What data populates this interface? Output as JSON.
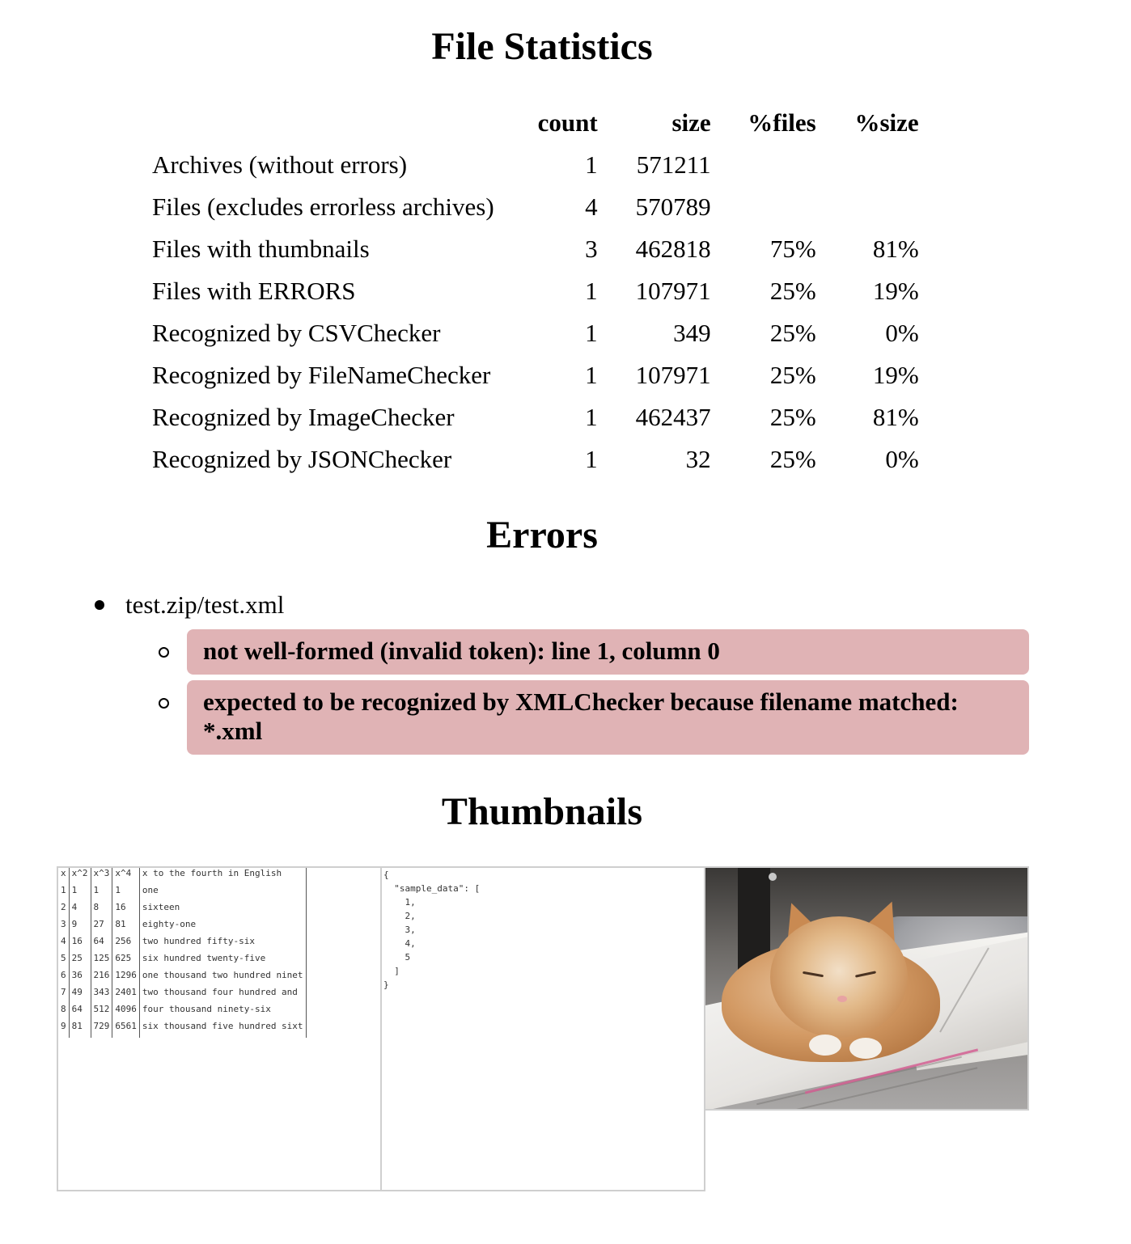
{
  "stats": {
    "title": "File Statistics",
    "headers": {
      "label": "",
      "count": "count",
      "size": "size",
      "pct_files": "%files",
      "pct_size": "%size"
    },
    "rows": [
      {
        "label": "Archives (without errors)",
        "count": "1",
        "size": "571211",
        "pct_files": "",
        "pct_size": ""
      },
      {
        "label": "Files (excludes errorless archives)",
        "count": "4",
        "size": "570789",
        "pct_files": "",
        "pct_size": ""
      },
      {
        "label": "Files with thumbnails",
        "count": "3",
        "size": "462818",
        "pct_files": "75%",
        "pct_size": "81%"
      },
      {
        "label": "Files with ERRORS",
        "count": "1",
        "size": "107971",
        "pct_files": "25%",
        "pct_size": "19%"
      },
      {
        "label": "Recognized by CSVChecker",
        "count": "1",
        "size": "349",
        "pct_files": "25%",
        "pct_size": "0%"
      },
      {
        "label": "Recognized by FileNameChecker",
        "count": "1",
        "size": "107971",
        "pct_files": "25%",
        "pct_size": "19%"
      },
      {
        "label": "Recognized by ImageChecker",
        "count": "1",
        "size": "462437",
        "pct_files": "25%",
        "pct_size": "81%"
      },
      {
        "label": "Recognized by JSONChecker",
        "count": "1",
        "size": "32",
        "pct_files": "25%",
        "pct_size": "0%"
      }
    ]
  },
  "errors": {
    "title": "Errors",
    "items": [
      {
        "file": "test.zip/test.xml",
        "messages": [
          "not well-formed (invalid token): line 1, column 0",
          "expected to be recognized by XMLChecker because filename matched: *.xml"
        ]
      }
    ],
    "message_bg": "#e0b3b5"
  },
  "thumbnails": {
    "title": "Thumbnails",
    "csv": {
      "rows": [
        [
          "x",
          "x^2",
          "x^3",
          "x^4",
          "x to the fourth in English"
        ],
        [
          "1",
          "1",
          "1",
          "1",
          "one"
        ],
        [
          "2",
          "4",
          "8",
          "16",
          "sixteen"
        ],
        [
          "3",
          "9",
          "27",
          "81",
          "eighty-one"
        ],
        [
          "4",
          "16",
          "64",
          "256",
          "two hundred fifty-six"
        ],
        [
          "5",
          "25",
          "125",
          "625",
          "six hundred twenty-five"
        ],
        [
          "6",
          "36",
          "216",
          "1296",
          "one thousand two hundred ninet"
        ],
        [
          "7",
          "49",
          "343",
          "2401",
          "two thousand four hundred and"
        ],
        [
          "8",
          "64",
          "512",
          "4096",
          "four thousand ninety-six"
        ],
        [
          "9",
          "81",
          "729",
          "6561",
          "six thousand five hundred sixt"
        ]
      ]
    },
    "json_text": "{\n  \"sample_data\": [\n    1,\n    2,\n    3,\n    4,\n    5\n  ]\n}",
    "image": {
      "subject": "cat-photo"
    }
  }
}
